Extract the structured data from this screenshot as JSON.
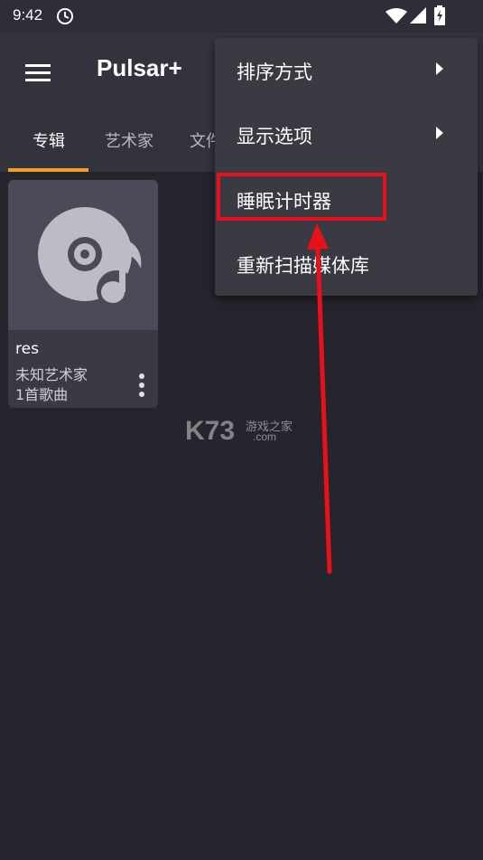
{
  "status_bar": {
    "time": "9:42",
    "icons": [
      "sync-icon",
      "wifi-icon",
      "signal-icon",
      "battery-charging-icon"
    ]
  },
  "app_bar": {
    "title": "Pulsar+",
    "menu_icon": "hamburger-icon"
  },
  "tabs": [
    {
      "label": "专辑",
      "active": true
    },
    {
      "label": "艺术家",
      "active": false
    },
    {
      "label": "文件",
      "active": false
    }
  ],
  "albums": [
    {
      "name": "res",
      "artist": "未知艺术家",
      "count": "1首歌曲",
      "art_icon": "disc-music-note-icon"
    }
  ],
  "popup_menu": {
    "items": [
      {
        "label": "排序方式",
        "has_submenu": true
      },
      {
        "label": "显示选项",
        "has_submenu": true
      },
      {
        "label": "睡眠计时器",
        "has_submenu": false,
        "highlighted": true
      },
      {
        "label": "重新扫描媒体库",
        "has_submenu": false
      }
    ]
  },
  "watermark": {
    "logo": "K73",
    "tagline": "游戏之家",
    "domain": ".com"
  },
  "colors": {
    "background": "#25252d",
    "app_bar": "#33333d",
    "accent": "#f0a02a",
    "popup": "#3a3a42",
    "annotation_red": "#e8101a"
  }
}
